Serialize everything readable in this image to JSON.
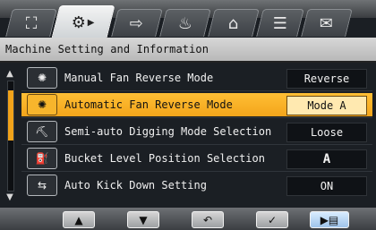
{
  "header": {
    "title": "Machine Setting and Information"
  },
  "tabs": [
    {
      "label": "⛶",
      "icon": "leaf-icon"
    },
    {
      "label": "⚙",
      "icon": "settings-icon",
      "sub": "▶"
    },
    {
      "label": "⇨",
      "icon": "arrow-icon"
    },
    {
      "label": "♨",
      "icon": "heater-icon"
    },
    {
      "label": "⌂",
      "icon": "machine-icon"
    },
    {
      "label": "☰",
      "icon": "list-icon"
    },
    {
      "label": "✉",
      "icon": "mail-icon"
    }
  ],
  "rows": [
    {
      "icon": "fan-icon",
      "icon_glyph": "✺",
      "label": "Manual Fan Reverse Mode",
      "value": "Reverse"
    },
    {
      "icon": "auto-fan-icon",
      "icon_glyph": "✺",
      "label": "Automatic Fan Reverse Mode",
      "value": "Mode A"
    },
    {
      "icon": "digging-icon",
      "icon_glyph": "⛏",
      "label": "Semi-auto Digging Mode Selection",
      "value": "Loose"
    },
    {
      "icon": "bucket-level-icon",
      "icon_glyph": "⛽",
      "label": "Bucket Level Position Selection",
      "value": "A"
    },
    {
      "icon": "kick-down-icon",
      "icon_glyph": "⇆",
      "label": "Auto Kick Down Setting",
      "value": "ON"
    }
  ],
  "footer": {
    "up": "▲",
    "down": "▼",
    "back": "↶",
    "confirm": "✓",
    "next": "▶▤"
  },
  "colors": {
    "accent": "#f3a51b",
    "background": "#1b1f24"
  }
}
